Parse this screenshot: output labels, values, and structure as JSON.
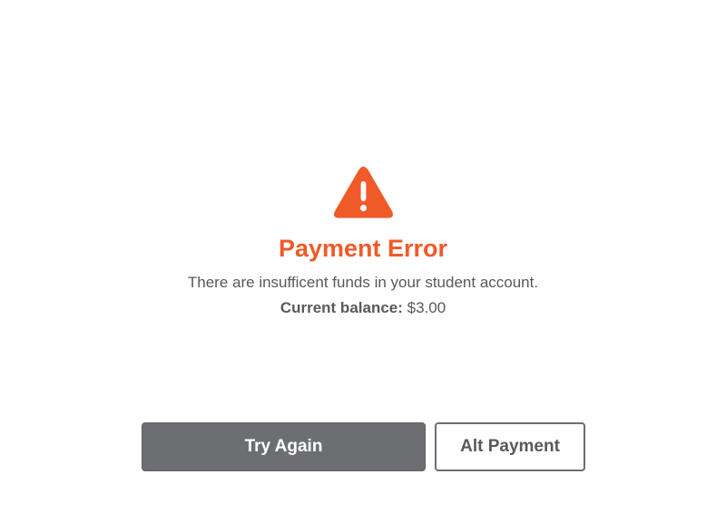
{
  "error": {
    "icon": "warning-triangle-icon",
    "accent_color": "#f05a28",
    "title": "Payment Error",
    "message": "There are insufficent funds in your student account.",
    "balance_label": "Current balance:",
    "balance_value": "$3.00"
  },
  "actions": {
    "try_again_label": "Try Again",
    "alt_payment_label": "Alt Payment",
    "primary_color": "#6d6e71"
  }
}
